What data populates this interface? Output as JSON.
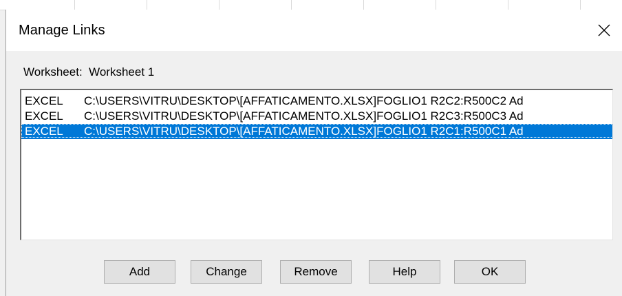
{
  "dialog": {
    "title": "Manage Links",
    "close_icon": "close-icon"
  },
  "worksheet": {
    "label": "Worksheet:  Worksheet 1"
  },
  "links": [
    {
      "type": "EXCEL",
      "path": "C:\\USERS\\VITRU\\DESKTOP\\[AFFATICAMENTO.XLSX]FOGLIO1 R2C2:R500C2 Ad",
      "selected": false
    },
    {
      "type": "EXCEL",
      "path": "C:\\USERS\\VITRU\\DESKTOP\\[AFFATICAMENTO.XLSX]FOGLIO1 R2C3:R500C3 Ad",
      "selected": false
    },
    {
      "type": "EXCEL",
      "path": "C:\\USERS\\VITRU\\DESKTOP\\[AFFATICAMENTO.XLSX]FOGLIO1 R2C1:R500C1 Ad",
      "selected": true
    }
  ],
  "buttons": {
    "add": "Add",
    "change": "Change",
    "remove": "Remove",
    "help": "Help",
    "ok": "OK"
  },
  "colors": {
    "selection": "#0078d7",
    "dialog_bg": "#f0f0f0",
    "button_bg": "#e1e1e1"
  }
}
